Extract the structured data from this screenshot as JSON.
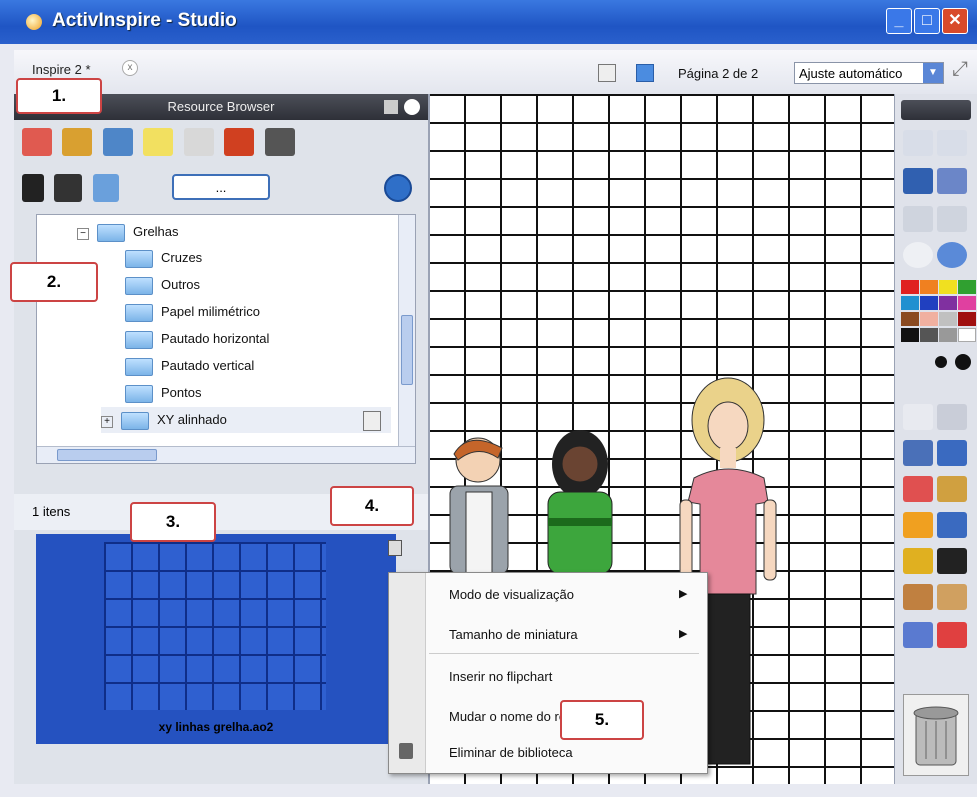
{
  "window": {
    "title": "ActivInspire - Studio",
    "min": "_",
    "max": "□",
    "close": "✕"
  },
  "toolbar": {
    "tab_label": "Inspire 2 *",
    "tab_close": "x",
    "page_indicator": "Página 2 de 2",
    "zoom_value": "Ajuste automático",
    "zoom_arrow": "▼"
  },
  "resource_browser": {
    "title": "Resource Browser",
    "dots_button": "...",
    "tree": [
      {
        "label": "Grelhas",
        "expand": "−"
      },
      {
        "label": "Cruzes"
      },
      {
        "label": "Outros"
      },
      {
        "label": "Papel milimétrico"
      },
      {
        "label": "Pautado horizontal"
      },
      {
        "label": "Pautado vertical"
      },
      {
        "label": "Pontos"
      },
      {
        "label": "XY alinhado",
        "expand": "+"
      }
    ],
    "item_count": "1 itens",
    "preview_label": "xy linhas  grelha.ao2"
  },
  "context_menu": {
    "items": [
      "Modo de visualização",
      "Tamanho de miniatura",
      "Inserir no flipchart",
      "Mudar o nome do recurso",
      "Eliminar de biblioteca"
    ],
    "submenu_arrow": "▶"
  },
  "callouts": [
    "1.",
    "2.",
    "3.",
    "4.",
    "5."
  ],
  "colors": {
    "titlebar": "#1f55c4",
    "preview_bg": "#2552c0",
    "callout_border": "#cc4444"
  }
}
